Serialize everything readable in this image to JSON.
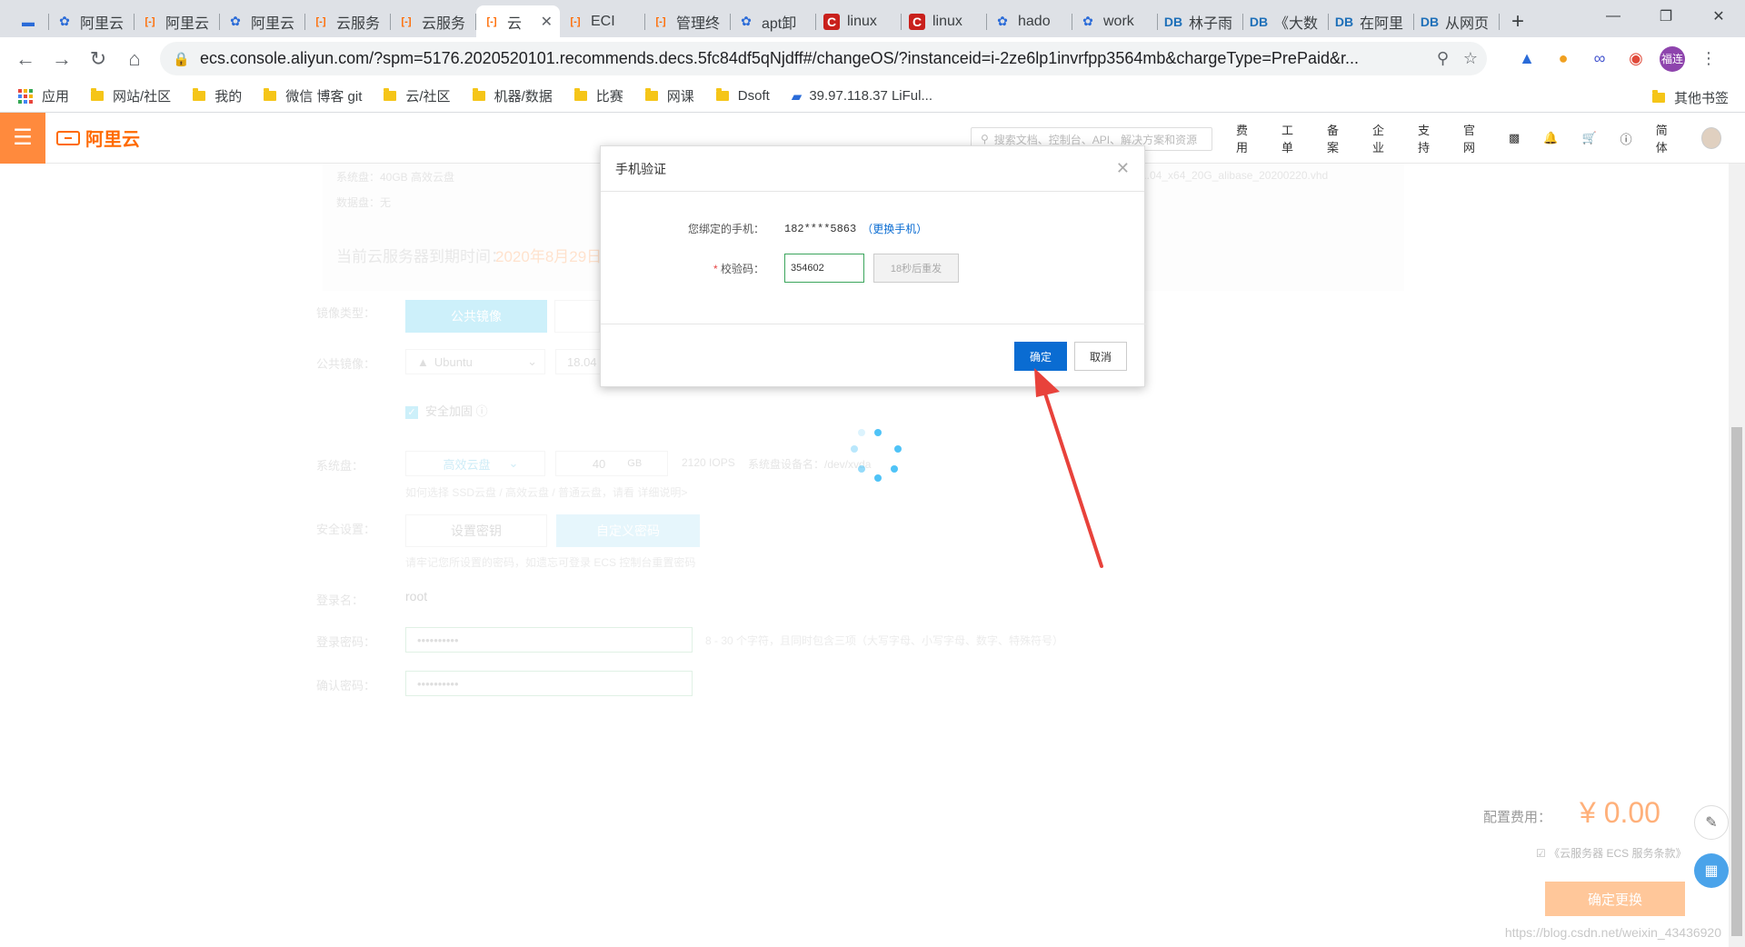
{
  "browser": {
    "tabs": [
      {
        "icon": "screen",
        "label": ""
      },
      {
        "icon": "paw",
        "label": "阿里云"
      },
      {
        "icon": "aliyun",
        "label": "阿里云"
      },
      {
        "icon": "paw",
        "label": "阿里云"
      },
      {
        "icon": "aliyun",
        "label": "云服务"
      },
      {
        "icon": "aliyun",
        "label": "云服务"
      },
      {
        "icon": "aliyun",
        "label": "云"
      },
      {
        "icon": "aliyun",
        "label": "ECI"
      },
      {
        "icon": "aliyun",
        "label": "管理终"
      },
      {
        "icon": "paw",
        "label": "apt卸"
      },
      {
        "icon": "csdn",
        "label": "linux"
      },
      {
        "icon": "csdn",
        "label": "linux"
      },
      {
        "icon": "paw",
        "label": "hado"
      },
      {
        "icon": "paw",
        "label": "work"
      },
      {
        "icon": "lab",
        "label": "林子雨"
      },
      {
        "icon": "lab",
        "label": "《大数"
      },
      {
        "icon": "lab",
        "label": "在阿里"
      },
      {
        "icon": "lab",
        "label": "从网页"
      }
    ],
    "url": "ecs.console.aliyun.com/?spm=5176.2020520101.recommends.decs.5fc84df5qNjdff#/changeOS/?instanceid=i-2ze6lp1invrfpp3564mb&chargeType=PrePaid&r...",
    "profile_label": "福连",
    "bookmarks": [
      {
        "label": "应用",
        "type": "apps"
      },
      {
        "label": "网站/社区",
        "type": "folder"
      },
      {
        "label": "我的",
        "type": "folder"
      },
      {
        "label": "微信 博客 git",
        "type": "folder"
      },
      {
        "label": "云/社区",
        "type": "folder"
      },
      {
        "label": "机器/数据",
        "type": "folder"
      },
      {
        "label": "比赛",
        "type": "folder"
      },
      {
        "label": "网课",
        "type": "folder"
      },
      {
        "label": "Dsoft",
        "type": "folder"
      },
      {
        "label": "39.97.118.37 LiFul...",
        "type": "site"
      }
    ],
    "other_bookmarks": "其他书签"
  },
  "console": {
    "logo": "阿里云",
    "search_placeholder": "搜索文档、控制台、API、解决方案和资源",
    "nav": [
      "费用",
      "工单",
      "备案",
      "企业",
      "支持",
      "官网"
    ],
    "lang": "简体",
    "system_disk_info": "系统盘：40GB 高效云盘",
    "data_disk_info": "数据盘：无",
    "image_file": "...04_x64_20G_alibase_20200220.vhd",
    "expire_label": "当前云服务器到期时间：",
    "expire_date": "2020年8月29日",
    "image_type_label": "镜像类型：",
    "public_image_btn": "公共镜像",
    "public_image_label": "公共镜像：",
    "os_name": "Ubuntu",
    "os_version": "18.04",
    "security_harden": "安全加固",
    "system_disk_label": "系统盘：",
    "disk_type": "高效云盘",
    "disk_size": "40",
    "disk_unit": "GB",
    "iops": "2120 IOPS",
    "device_name": "系统盘设备名：/dev/xvda",
    "disk_hint": "如何选择 SSD云盘 / 高效云盘 / 普通云盘，请看 详细说明>",
    "security_label": "安全设置：",
    "set_key_btn": "设置密钥",
    "custom_pwd_btn": "自定义密码",
    "pwd_hint": "请牢记您所设置的密码，如遗忘可登录 ECS 控制台重置密码",
    "login_name_label": "登录名：",
    "login_name": "root",
    "login_pwd_label": "登录密码：",
    "login_pwd": "••••••••••",
    "pwd_rule": "8 - 30 个字符，且同时包含三项（大写字母、小写字母、数字、特殊符号）",
    "confirm_pwd_label": "确认密码：",
    "confirm_pwd": "••••••••••",
    "fee_label": "配置费用：",
    "fee_value": "¥ 0.00",
    "agreement": "《云服务器 ECS 服务条款》",
    "confirm_replace_btn": "确定更换",
    "watermark": "https://blog.csdn.net/weixin_43436920"
  },
  "modal": {
    "title": "手机验证",
    "phone_label": "您绑定的手机：",
    "phone_value": "182****5863",
    "change_phone": "（更换手机）",
    "code_label": "校验码：",
    "code_value": "354602",
    "resend": "18秒后重发",
    "ok": "确定",
    "cancel": "取消"
  },
  "colors": {
    "accent": "#ff6a00",
    "primary_btn": "#0a6cd2",
    "annotation_arrow": "#e8423b"
  }
}
